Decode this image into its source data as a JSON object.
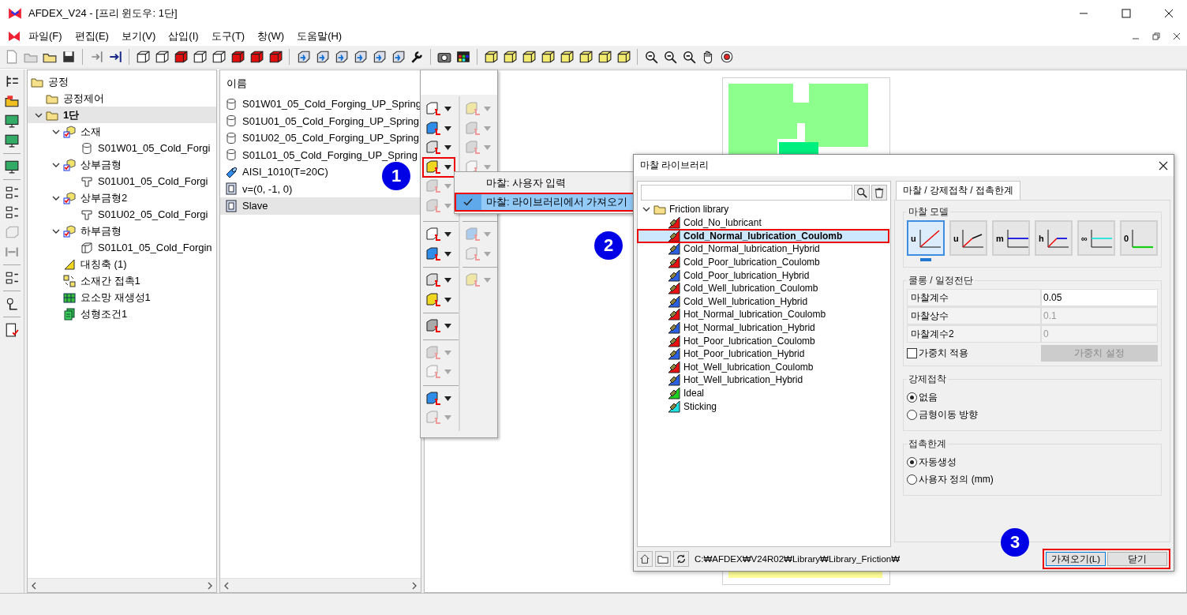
{
  "window": {
    "title": "AFDEX_V24 - [프리 윈도우: 1단]"
  },
  "menu": [
    "파일(F)",
    "편집(E)",
    "보기(V)",
    "삽입(I)",
    "도구(T)",
    "창(W)",
    "도움말(H)"
  ],
  "tree": [
    {
      "label": "공정",
      "kind": "folder",
      "selected": false,
      "children": [
        {
          "label": "공정제어",
          "kind": "folder",
          "selected": false
        },
        {
          "label": "1단",
          "kind": "folder",
          "selected": true,
          "expanded": true,
          "children": [
            {
              "label": "소재",
              "kind": "material",
              "selected": false,
              "expanded": true,
              "children": [
                {
                  "label": "S01W01_05_Cold_Forgi",
                  "kind": "billet",
                  "selected": false
                }
              ]
            },
            {
              "label": "상부금형",
              "kind": "die",
              "selected": false,
              "expanded": true,
              "children": [
                {
                  "label": "S01U01_05_Cold_Forgi",
                  "kind": "punch",
                  "selected": false
                }
              ]
            },
            {
              "label": "상부금형2",
              "kind": "die",
              "selected": false,
              "expanded": true,
              "children": [
                {
                  "label": "S01U02_05_Cold_Forgi",
                  "kind": "punch",
                  "selected": false
                }
              ]
            },
            {
              "label": "하부금형",
              "kind": "die",
              "selected": false,
              "expanded": true,
              "children": [
                {
                  "label": "S01L01_05_Cold_Forgin",
                  "kind": "lowerpart",
                  "selected": false
                }
              ]
            },
            {
              "label": "대칭축 (1)",
              "kind": "axis",
              "selected": false
            },
            {
              "label": "소재간 접촉1",
              "kind": "contact",
              "selected": false
            },
            {
              "label": "요소망 재생성1",
              "kind": "mesh",
              "selected": false
            },
            {
              "label": "성형조건1",
              "kind": "condition",
              "selected": false
            }
          ]
        }
      ]
    }
  ],
  "list": {
    "header": "이름",
    "rows": [
      {
        "label": "S01W01_05_Cold_Forging_UP_Spring",
        "kind": "billet",
        "selected": false
      },
      {
        "label": "S01U01_05_Cold_Forging_UP_Spring",
        "kind": "billet",
        "selected": false
      },
      {
        "label": "S01U02_05_Cold_Forging_UP_Spring",
        "kind": "billet",
        "selected": false
      },
      {
        "label": "S01L01_05_Cold_Forging_UP_Spring",
        "kind": "billet",
        "selected": false
      },
      {
        "label": "AISI_1010(T=20C)",
        "kind": "steel",
        "selected": false
      },
      {
        "label": "v=(0, -1, 0)",
        "kind": "velocity",
        "selected": false
      },
      {
        "label": "Slave",
        "kind": "velocity",
        "selected": true
      }
    ]
  },
  "palette": {
    "columns": [
      [
        [
          {
            "enabled": true,
            "highlighted": false
          },
          {
            "enabled": true,
            "highlighted": false
          },
          {
            "enabled": true,
            "highlighted": false
          },
          {
            "enabled": true,
            "highlighted": true
          },
          {
            "enabled": false,
            "highlighted": false
          },
          {
            "enabled": false,
            "highlighted": false
          }
        ],
        [
          {
            "enabled": true,
            "highlighted": false
          },
          {
            "enabled": true,
            "highlighted": false
          }
        ],
        [
          {
            "enabled": true,
            "highlighted": false
          },
          {
            "enabled": true,
            "highlighted": false
          }
        ],
        [
          {
            "enabled": true,
            "highlighted": false
          }
        ],
        [
          {
            "enabled": false,
            "highlighted": false
          },
          {
            "enabled": false,
            "highlighted": false
          }
        ],
        [
          {
            "enabled": true,
            "highlighted": false
          },
          {
            "enabled": false,
            "highlighted": false
          }
        ]
      ],
      [
        [
          {
            "enabled": false,
            "highlighted": false
          },
          {
            "enabled": false,
            "highlighted": false
          },
          {
            "enabled": false,
            "highlighted": false
          },
          {
            "enabled": false,
            "highlighted": false
          }
        ],
        [
          {
            "enabled": false,
            "highlighted": false
          },
          {
            "enabled": false,
            "highlighted": false
          }
        ],
        [
          {
            "enabled": false,
            "highlighted": false
          }
        ]
      ]
    ]
  },
  "context_menu": [
    {
      "label": "마찰: 사용자 입력",
      "checked": false,
      "selected": false,
      "highlighted": false
    },
    {
      "label": "마찰: 라이브러리에서 가져오기",
      "checked": true,
      "selected": true,
      "highlighted": true
    }
  ],
  "dialog": {
    "title": "마찰 라이브러리",
    "library": {
      "label": "Friction library",
      "expanded": true,
      "children": [
        {
          "label": "Cold_No_lubricant",
          "kind": "coulomb",
          "selected": false,
          "highlighted": false
        },
        {
          "label": "Cold_Normal_lubrication_Coulomb",
          "kind": "coulomb",
          "selected": true,
          "highlighted": true
        },
        {
          "label": "Cold_Normal_lubrication_Hybrid",
          "kind": "hybrid",
          "selected": false,
          "highlighted": false
        },
        {
          "label": "Cold_Poor_lubrication_Coulomb",
          "kind": "coulomb",
          "selected": false,
          "highlighted": false
        },
        {
          "label": "Cold_Poor_lubrication_Hybrid",
          "kind": "hybrid",
          "selected": false,
          "highlighted": false
        },
        {
          "label": "Cold_Well_lubrication_Coulomb",
          "kind": "coulomb",
          "selected": false,
          "highlighted": false
        },
        {
          "label": "Cold_Well_lubrication_Hybrid",
          "kind": "hybrid",
          "selected": false,
          "highlighted": false
        },
        {
          "label": "Hot_Normal_lubrication_Coulomb",
          "kind": "coulomb",
          "selected": false,
          "highlighted": false
        },
        {
          "label": "Hot_Normal_lubrication_Hybrid",
          "kind": "hybrid",
          "selected": false,
          "highlighted": false
        },
        {
          "label": "Hot_Poor_lubrication_Coulomb",
          "kind": "coulomb",
          "selected": false,
          "highlighted": false
        },
        {
          "label": "Hot_Poor_lubrication_Hybrid",
          "kind": "hybrid",
          "selected": false,
          "highlighted": false
        },
        {
          "label": "Hot_Well_lubrication_Coulomb",
          "kind": "coulomb",
          "selected": false,
          "highlighted": false
        },
        {
          "label": "Hot_Well_lubrication_Hybrid",
          "kind": "hybrid",
          "selected": false,
          "highlighted": false
        },
        {
          "label": "Ideal",
          "kind": "ideal",
          "selected": false,
          "highlighted": false
        },
        {
          "label": "Sticking",
          "kind": "sticking",
          "selected": false,
          "highlighted": false
        }
      ]
    },
    "tabs": [
      {
        "label": "마찰 / 강제접착 / 접촉한계",
        "selected": true
      }
    ],
    "model_group": {
      "title": "마찰 모델",
      "models": [
        {
          "symbol": "u",
          "kind": "linear",
          "selected": true
        },
        {
          "symbol": "u",
          "kind": "bilinear",
          "selected": false
        },
        {
          "symbol": "m",
          "kind": "constant",
          "selected": false
        },
        {
          "symbol": "h",
          "kind": "hybrid",
          "selected": false
        },
        {
          "symbol": "∞",
          "kind": "infinite",
          "selected": false
        },
        {
          "symbol": "0",
          "kind": "zero",
          "selected": false
        }
      ]
    },
    "coulomb_group": {
      "title": "쿨롱 / 일정전단",
      "rows": [
        {
          "label": "마찰계수",
          "value": "0.05",
          "disabled": false
        },
        {
          "label": "마찰상수",
          "value": "0.1",
          "disabled": true
        },
        {
          "label": "마찰계수2",
          "value": "0",
          "disabled": true
        }
      ],
      "checkbox": {
        "label": "가중치 적용",
        "checked": false
      },
      "button": {
        "label": "가중치 설정",
        "disabled": true
      }
    },
    "sticking_group": {
      "title": "강제접착",
      "options": [
        {
          "label": "없음",
          "selected": true
        },
        {
          "label": "금형이동 방향",
          "selected": false
        }
      ]
    },
    "limit_group": {
      "title": "접촉한계",
      "options": [
        {
          "label": "자동생성",
          "selected": true
        },
        {
          "label": "사용자 정의 (mm)",
          "selected": false
        }
      ]
    },
    "path": "C:₩AFDEX₩V24R02₩Library₩Library_Friction₩",
    "actions": {
      "highlighted": true,
      "buttons": [
        {
          "label": "가져오기(L)",
          "default": true
        },
        {
          "label": "닫기",
          "default": false
        }
      ]
    }
  },
  "markers": [
    {
      "number": "1"
    },
    {
      "number": "2"
    },
    {
      "number": "3"
    }
  ]
}
